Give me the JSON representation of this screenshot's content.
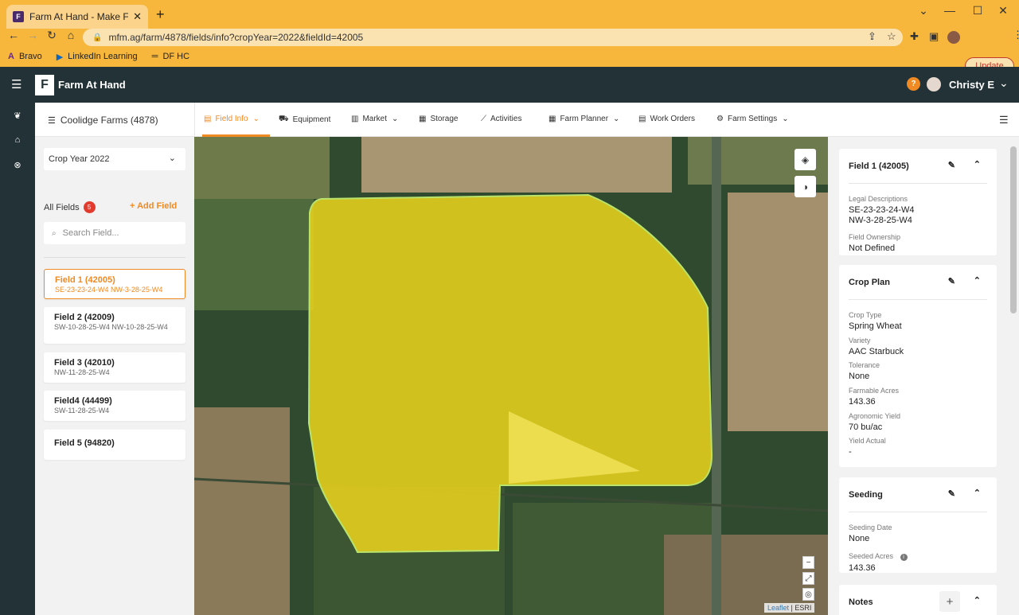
{
  "browser": {
    "tab_title": "Farm At Hand - Make Farm Mana",
    "favicon_letter": "F",
    "url": "mfm.ag/farm/4878/fields/info?cropYear=2022&fieldId=42005",
    "update_label": "Update",
    "bookmarks": [
      {
        "icon": "bravo-icon",
        "label": "Bravo"
      },
      {
        "icon": "linkedin-icon",
        "label": "LinkedIn Learning"
      },
      {
        "icon": "dfhc-icon",
        "label": "DF HC"
      }
    ]
  },
  "app": {
    "logo_letter": "F",
    "name": "Farm At Hand",
    "help_glyph": "?",
    "user_name": "Christy E"
  },
  "nav": {
    "farm_name": "Coolidge Farms (4878)",
    "tabs": [
      {
        "label": "Field Info",
        "icon": "field-info-icon",
        "dropdown": true,
        "active": true
      },
      {
        "label": "Equipment",
        "icon": "tractor-icon",
        "dropdown": false
      },
      {
        "label": "Market",
        "icon": "chart-icon",
        "dropdown": true
      },
      {
        "label": "Storage",
        "icon": "storage-icon",
        "dropdown": false
      },
      {
        "label": "Activities",
        "icon": "activity-icon",
        "dropdown": false
      },
      {
        "label": "Farm Planner",
        "icon": "calendar-icon",
        "dropdown": true
      },
      {
        "label": "Work Orders",
        "icon": "clipboard-icon",
        "dropdown": false
      },
      {
        "label": "Farm Settings",
        "icon": "gear-icon",
        "dropdown": true
      }
    ]
  },
  "left": {
    "crop_year": "Crop Year 2022",
    "all_fields_label": "All Fields",
    "field_count": "5",
    "add_field_label": "+ Add Field",
    "search_placeholder": "Search Field...",
    "fields": [
      {
        "name": "Field 1 (42005)",
        "legal": "SE-23-23-24-W4 NW-3-28-25-W4",
        "selected": true
      },
      {
        "name": "Field 2 (42009)",
        "legal": "SW-10-28-25-W4 NW-10-28-25-W4",
        "selected": false
      },
      {
        "name": "Field 3 (42010)",
        "legal": "NW-11-28-25-W4",
        "selected": false
      },
      {
        "name": "Field4 (44499)",
        "legal": "SW-11-28-25-W4",
        "selected": false
      },
      {
        "name": "Field 5 (94820)",
        "legal": "",
        "selected": false
      }
    ]
  },
  "map": {
    "zoom_out": "−",
    "attribution_leaflet": "Leaflet",
    "attribution_esri": "| ESRI",
    "field_fill": "#e8d21c"
  },
  "right": {
    "field_card": {
      "title": "Field 1 (42005)",
      "legal_label": "Legal Descriptions",
      "legal_values": [
        "SE-23-23-24-W4",
        "NW-3-28-25-W4"
      ],
      "ownership_label": "Field Ownership",
      "ownership_value": "Not Defined"
    },
    "crop_plan": {
      "title": "Crop Plan",
      "items": [
        {
          "label": "Crop Type",
          "value": "Spring Wheat"
        },
        {
          "label": "Variety",
          "value": "AAC Starbuck"
        },
        {
          "label": "Tolerance",
          "value": "None"
        },
        {
          "label": "Farmable Acres",
          "value": "143.36"
        },
        {
          "label": "Agronomic Yield",
          "value": "70 bu/ac"
        },
        {
          "label": "Yield Actual",
          "value": "-"
        }
      ]
    },
    "seeding": {
      "title": "Seeding",
      "seeding_date_label": "Seeding Date",
      "seeding_date_value": "None",
      "seeded_acres_label": "Seeded Acres",
      "seeded_acres_value": "143.36"
    },
    "notes": {
      "title": "Notes",
      "add_glyph": "+"
    }
  },
  "colors": {
    "accent": "#f08a24",
    "header": "#233236",
    "chrome": "#f6b73c",
    "badge": "#e23b2e"
  }
}
